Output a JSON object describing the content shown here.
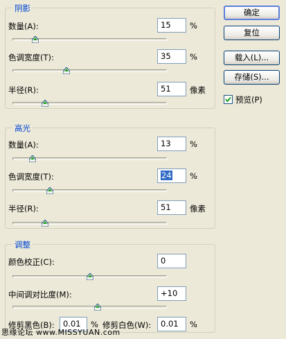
{
  "shadows": {
    "title": "阴影",
    "amount_label": "数量(A):",
    "amount_value": "15",
    "amount_unit": "%",
    "amount_level": 0.15,
    "tonal_width_label": "色调宽度(T):",
    "tonal_width_value": "35",
    "tonal_width_unit": "%",
    "tonal_width_level": 0.35,
    "radius_label": "半径(R):",
    "radius_value": "51",
    "radius_unit": "像素",
    "radius_level": 0.21
  },
  "highlights": {
    "title": "高光",
    "amount_label": "数量(A):",
    "amount_value": "13",
    "amount_unit": "%",
    "amount_level": 0.13,
    "tonal_width_label": "色调宽度(T):",
    "tonal_width_value": "24",
    "tonal_width_unit": "%",
    "tonal_width_level": 0.24,
    "radius_label": "半径(R):",
    "radius_value": "51",
    "radius_unit": "像素",
    "radius_level": 0.21
  },
  "adjustments": {
    "title": "调整",
    "color_correction_label": "颜色校正(C):",
    "color_correction_value": "0",
    "color_correction_level": 0.5,
    "midtone_contrast_label": "中间调对比度(M):",
    "midtone_contrast_value": "+10",
    "midtone_contrast_level": 0.55,
    "black_clip_label": "修剪黑色(B):",
    "black_clip_value": "0.01",
    "black_clip_unit": "%",
    "white_clip_label": "修剪白色(W):",
    "white_clip_value": "0.01",
    "white_clip_unit": "%"
  },
  "buttons": {
    "ok": "确定",
    "reset": "复位",
    "load": "载入(L)...",
    "save": "存储(S)..."
  },
  "preview": {
    "label": "预览(P)",
    "checked": true
  },
  "watermark": "思缘论坛 www.MISSYUAN.com"
}
